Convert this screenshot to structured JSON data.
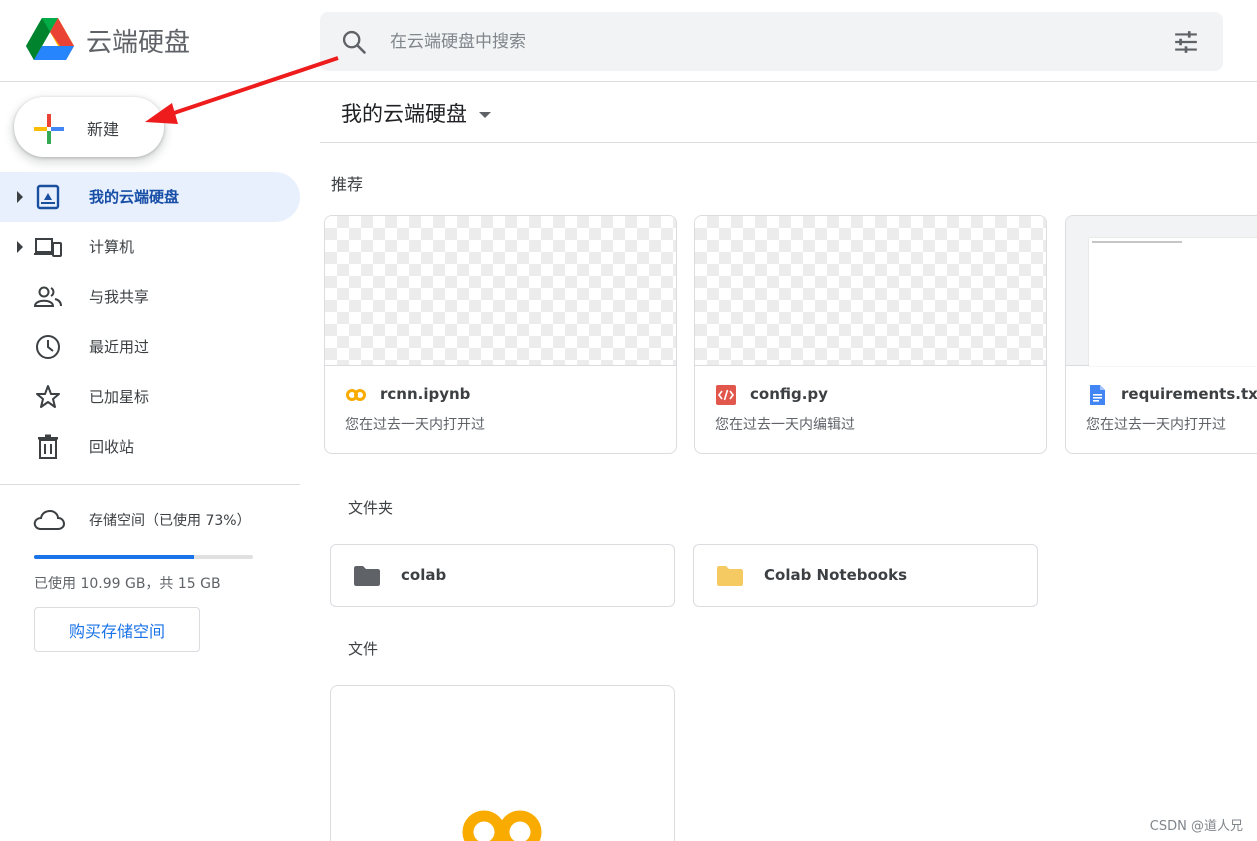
{
  "header": {
    "app_title": "云端硬盘",
    "search_placeholder": "在云端硬盘中搜索"
  },
  "sidebar": {
    "new_label": "新建",
    "items": [
      {
        "label": "我的云端硬盘",
        "icon": "my-drive-icon",
        "active": true,
        "expandable": true
      },
      {
        "label": "计算机",
        "icon": "computers-icon",
        "active": false,
        "expandable": true
      },
      {
        "label": "与我共享",
        "icon": "shared-with-me-icon",
        "active": false,
        "expandable": false
      },
      {
        "label": "最近用过",
        "icon": "recent-icon",
        "active": false,
        "expandable": false
      },
      {
        "label": "已加星标",
        "icon": "star-icon",
        "active": false,
        "expandable": false
      },
      {
        "label": "回收站",
        "icon": "trash-icon",
        "active": false,
        "expandable": false
      }
    ],
    "storage": {
      "label": "存储空间（已使用 73%）",
      "percent_used": 73,
      "used_text": "已使用 10.99 GB，共 15 GB",
      "buy_label": "购买存储空间"
    }
  },
  "main": {
    "title": "我的云端硬盘",
    "suggested_label": "推荐",
    "suggested": [
      {
        "name": "rcnn.ipynb",
        "subtitle": "您在过去一天内打开过",
        "icon": "colab-icon"
      },
      {
        "name": "config.py",
        "subtitle": "您在过去一天内编辑过",
        "icon": "code-file-icon"
      },
      {
        "name": "requirements.txt",
        "subtitle": "您在过去一天内打开过",
        "icon": "doc-icon"
      }
    ],
    "folders_label": "文件夹",
    "folders": [
      {
        "name": "colab",
        "color": "#5f6368"
      },
      {
        "name": "Colab Notebooks",
        "color": "#f6ca63"
      }
    ],
    "files_label": "文件"
  },
  "colors": {
    "accent": "#1a73e8",
    "active_bg": "#e8f0fe",
    "arrow": "#ee1c1c",
    "colab_orange": "#f9ab00",
    "code_red": "#e2574c"
  },
  "watermark": "CSDN @道人兄"
}
